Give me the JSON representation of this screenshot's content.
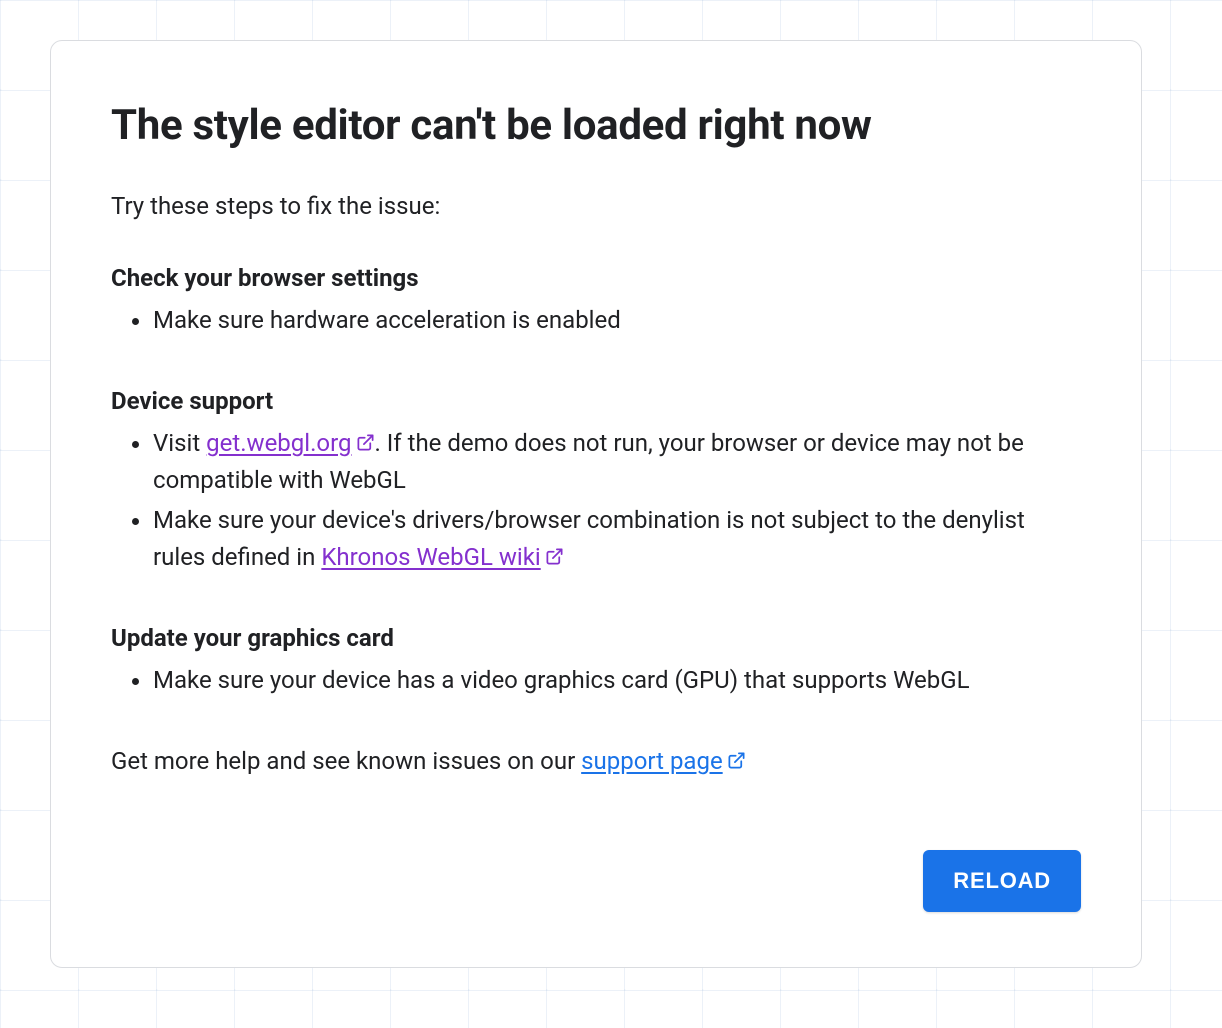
{
  "title": "The style editor can't be loaded right now",
  "intro": "Try these steps to fix the issue:",
  "sections": [
    {
      "heading": "Check your browser settings",
      "items": [
        {
          "prefix": "",
          "link": "",
          "suffix": "Make sure hardware acceleration is enabled"
        }
      ]
    },
    {
      "heading": "Device support",
      "items": [
        {
          "prefix": "Visit ",
          "link": "get.webgl.org",
          "suffix": ". If the demo does not run, your browser or device may not be compatible with WebGL"
        },
        {
          "prefix": "Make sure your device's drivers/browser combination is not subject to the denylist rules defined in ",
          "link": "Khronos WebGL wiki",
          "suffix": ""
        }
      ]
    },
    {
      "heading": "Update your graphics card",
      "items": [
        {
          "prefix": "",
          "link": "",
          "suffix": "Make sure your device has a video graphics card (GPU) that supports WebGL"
        }
      ]
    }
  ],
  "footer": {
    "prefix": "Get more help and see known issues on our ",
    "link": "support page"
  },
  "reload_label": "RELOAD",
  "colors": {
    "link_visited": "#8430ce",
    "link_blue": "#1a73e8",
    "button_bg": "#1a73e8"
  }
}
